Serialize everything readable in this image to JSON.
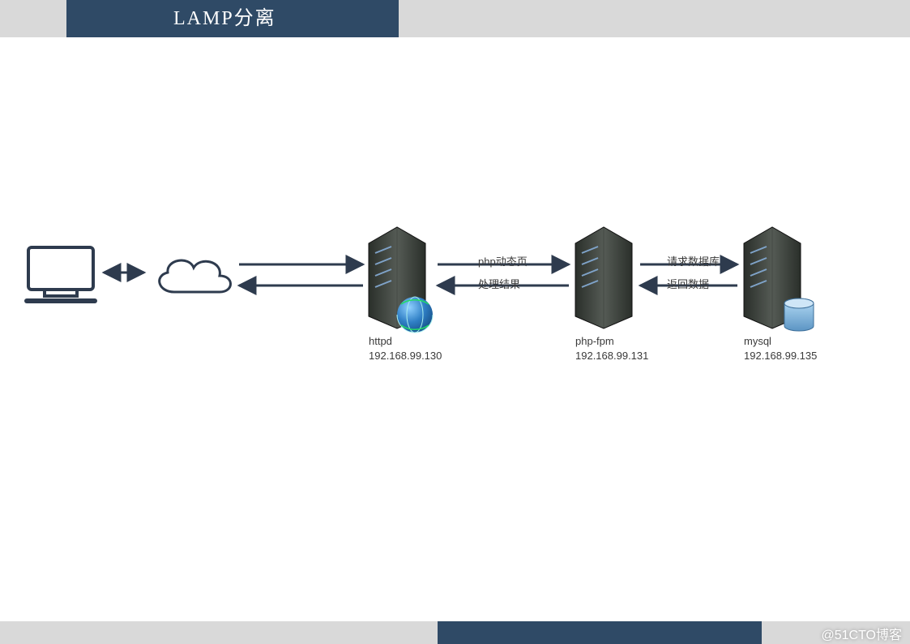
{
  "title": "LAMP分离",
  "watermark": "@51CTO博客",
  "nodes": {
    "httpd": {
      "name": "httpd",
      "ip": "192.168.99.130"
    },
    "phpfpm": {
      "name": "php-fpm",
      "ip": "192.168.99.131"
    },
    "mysql": {
      "name": "mysql",
      "ip": "192.168.99.135"
    }
  },
  "connections": {
    "httpd_php_top": "php动态页",
    "httpd_php_bottom": "处理结果",
    "php_mysql_top": "请求数据库",
    "php_mysql_bottom": "返回数据"
  },
  "colors": {
    "header": "#2f4a66",
    "arrow": "#2e3b4e",
    "server_dark": "#222722",
    "server_light": "#444944",
    "globe": "#3d8dcc",
    "db": "#7fb1d6"
  }
}
